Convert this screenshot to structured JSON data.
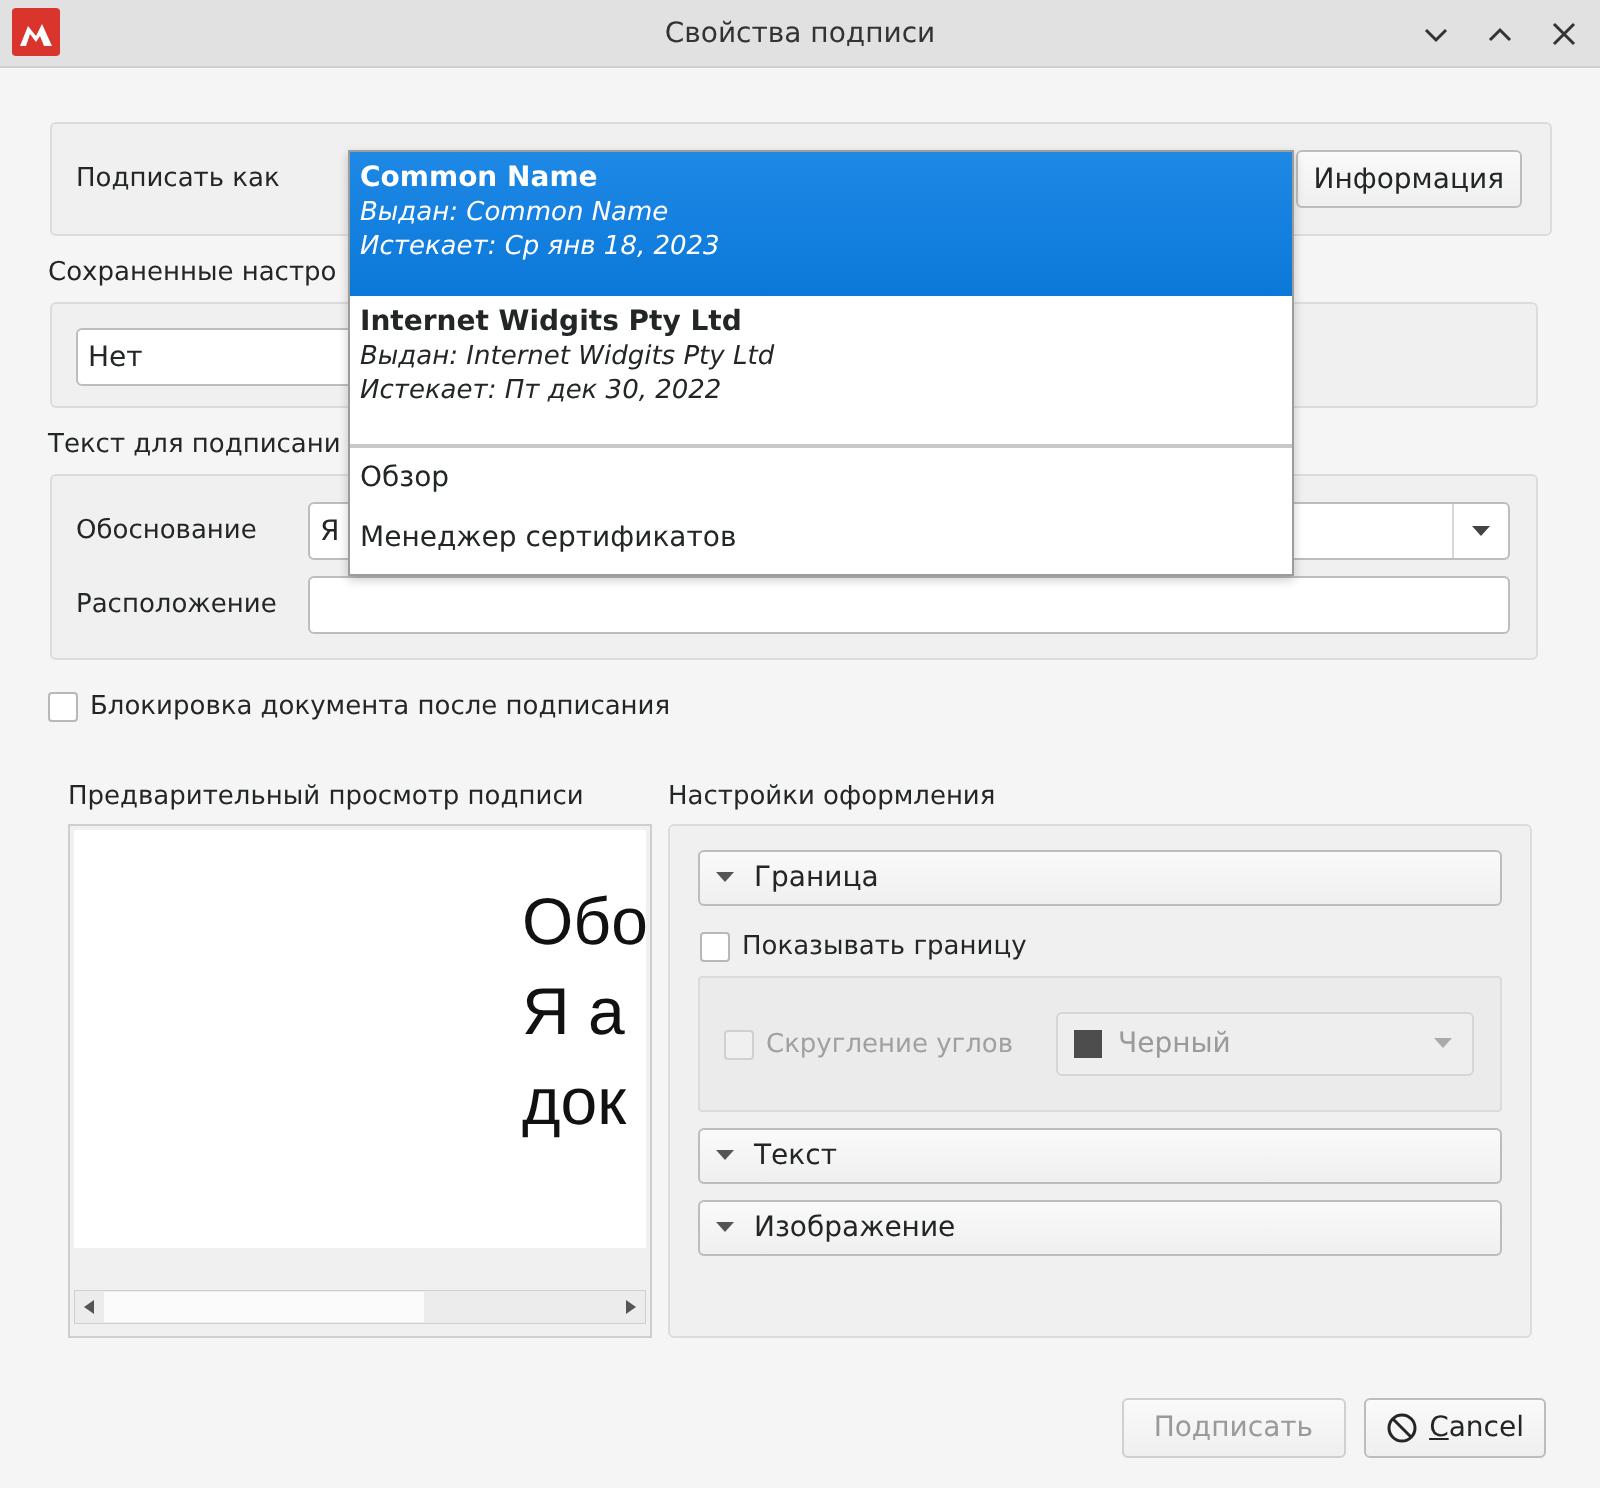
{
  "window": {
    "title": "Свойства подписи"
  },
  "sign_as": {
    "label": "Подписать как",
    "info_button": {
      "label": "Информация"
    }
  },
  "saved_settings": {
    "label": "Сохраненные настро",
    "value": "Нет"
  },
  "sign_text": {
    "label": "Текст для подписани",
    "fields": [
      {
        "kind": "combo",
        "label": "Обоснование",
        "value": "Я"
      },
      {
        "kind": "text",
        "label": "Расположение"
      }
    ]
  },
  "lock_document": {
    "label": "Блокировка документа после подписания",
    "checked": false
  },
  "preview": {
    "label": "Предварительный просмотр подписи",
    "lines": [
      "Обо",
      "Я а",
      "док"
    ]
  },
  "appearance": {
    "label": "Настройки оформления",
    "sections": [
      {
        "label": "Граница",
        "kind": "border"
      },
      {
        "label": "Текст",
        "kind": "plain"
      },
      {
        "label": "Изображение",
        "kind": "plain"
      }
    ],
    "show_border": {
      "label": "Показывать границу",
      "checked": false
    },
    "round_corners": {
      "label": "Скругление углов",
      "checked": false,
      "disabled": true
    },
    "border_color": {
      "value": "Черный",
      "disabled": true
    }
  },
  "buttons": [
    {
      "kind": "sign",
      "label": "Подписать",
      "disabled": true
    },
    {
      "kind": "cancel",
      "label": "Cancel",
      "disabled": false
    }
  ],
  "popup": {
    "certificates": [
      {
        "name": "Common Name",
        "issued": "Выдан: Common Name",
        "expires": "Истекает: Ср янв 18, 2023",
        "selected": true
      },
      {
        "name": "Internet Widgits Pty Ltd",
        "issued": "Выдан: Internet Widgits Pty Ltd",
        "expires": "Истекает: Пт дек 30, 2022",
        "selected": false
      }
    ],
    "actions": [
      "Обзор",
      "Менеджер сертификатов"
    ]
  }
}
